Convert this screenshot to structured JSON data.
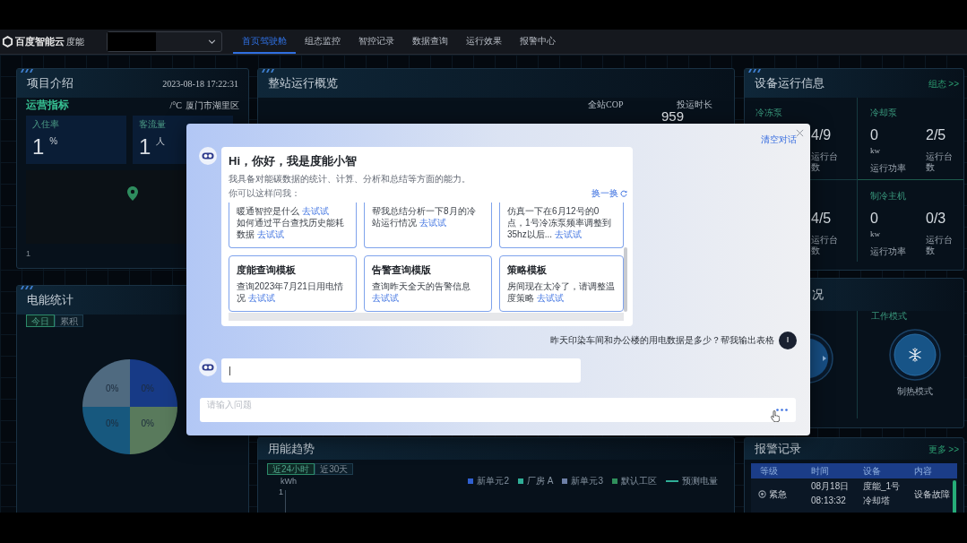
{
  "nav": {
    "logo": "百度智能云",
    "product": "度能",
    "tabs": [
      {
        "label": "首页驾驶舱",
        "selected": true
      },
      {
        "label": "组态监控",
        "selected": false
      },
      {
        "label": "智控记录",
        "selected": false
      },
      {
        "label": "数据查询",
        "selected": false
      },
      {
        "label": "运行效果",
        "selected": false
      },
      {
        "label": "报警中心",
        "selected": false
      }
    ]
  },
  "project_panel": {
    "title": "项目介绍",
    "datetime": "2023-08-18 17:22:31",
    "section": "运营指标",
    "weather": "/°C",
    "location": "厦门市湖里区",
    "stats": [
      {
        "label": "入住率",
        "value": "1",
        "unit": "%"
      },
      {
        "label": "客流量",
        "value": "1",
        "unit": "人"
      }
    ],
    "footer": "1"
  },
  "energy_panel": {
    "title": "电能统计",
    "tabs": [
      {
        "label": "今日",
        "selected": true
      },
      {
        "label": "累积",
        "selected": false
      }
    ],
    "slices": [
      {
        "label": "0%",
        "color": "#4f6a80"
      },
      {
        "label": "0%",
        "color": "#173a86"
      },
      {
        "label": "0%",
        "color": "#17587e"
      },
      {
        "label": "0%",
        "color": "#597a5c"
      }
    ]
  },
  "overview_panel": {
    "title": "整站运行概览",
    "metrics": [
      {
        "label": "全站COP"
      },
      {
        "label": "投运时长",
        "value": "959"
      }
    ]
  },
  "device_panel": {
    "title": "设备运行信息",
    "link": "组态 >>",
    "rows": [
      {
        "groups": [
          {
            "title": "冷冻泵",
            "metrics": [
              {
                "kind": "count",
                "value": "4/9",
                "label": "运行台数"
              }
            ]
          },
          {
            "title": "冷却泵",
            "metrics": [
              {
                "kind": "power",
                "value": "0",
                "unit": "kw",
                "label": "运行功率"
              },
              {
                "kind": "count",
                "value": "2/5",
                "label": "运行台数"
              }
            ]
          }
        ]
      },
      {
        "groups": [
          {
            "metrics": [
              {
                "kind": "count",
                "value": "4/5",
                "label": "运行台数"
              }
            ]
          },
          {
            "title": "制冷主机",
            "metrics": [
              {
                "kind": "power",
                "value": "0",
                "unit": "kw",
                "label": "运行功率"
              },
              {
                "kind": "count",
                "value": "0/3",
                "label": "运行台数"
              }
            ]
          }
        ]
      }
    ]
  },
  "mode_panel": {
    "title": "况",
    "mode": {
      "label": "工作模式",
      "value": "制热模式"
    }
  },
  "trend_panel": {
    "title": "用能趋势",
    "tabs": [
      {
        "label": "近24小时",
        "selected": true
      },
      {
        "label": "近30天",
        "selected": false
      }
    ],
    "unit": "kWh",
    "y_tick": "1",
    "legend": [
      {
        "kind": "square",
        "label": "新单元2",
        "color": "#2f5fd0"
      },
      {
        "kind": "square",
        "label": "厂房 A",
        "color": "#2fae97"
      },
      {
        "kind": "square",
        "label": "新单元3",
        "color": "#6d7fa6"
      },
      {
        "kind": "square",
        "label": "默认工区",
        "color": "#2f8f5b"
      },
      {
        "kind": "line",
        "label": "预测电量",
        "color": "#2fae97"
      }
    ]
  },
  "alarm_panel": {
    "title": "报警记录",
    "link": "更多 >>",
    "columns": [
      "等级",
      "时间",
      "设备",
      "内容"
    ],
    "rows": [
      {
        "level": "紧急",
        "time": [
          "08月18日",
          "08:13:32"
        ],
        "device": [
          "度能_1号",
          "冷却塔"
        ],
        "content": "设备故障"
      }
    ]
  },
  "assistant": {
    "clear_label": "清空对话",
    "welcome": {
      "title": "Hi，你好，我是度能小智",
      "intro": "我具备对能碳数据的统计、计算、分析和总结等方面的能力。",
      "prompt": "你可以这样问我：",
      "refresh": "换一换",
      "suggestions": [
        {
          "items": [
            {
              "text": "暖通智控是什么",
              "link": "去试试"
            },
            {
              "text": "如何通过平台查找历史能耗数据",
              "link": "去试试"
            }
          ]
        },
        {
          "items": [
            {
              "text": "帮我总结分析一下8月的冷站运行情况",
              "link": "去试试"
            }
          ]
        },
        {
          "items": [
            {
              "text": "仿真一下在6月12号的0点，1号冷冻泵频率调整到35hz以后...",
              "link": "去试试"
            }
          ]
        },
        {
          "title": "度能查询模板",
          "items": [
            {
              "text": "查询2023年7月21日用电情况",
              "link": "去试试"
            }
          ]
        },
        {
          "title": "告警查询模版",
          "items": [
            {
              "text": "查询昨天全天的告警信息",
              "link": "去试试"
            }
          ]
        },
        {
          "title": "策略模板",
          "items": [
            {
              "text": "房间现在太冷了，请调整温度策略",
              "link": "去试试"
            }
          ]
        }
      ]
    },
    "messages": [
      {
        "kind": "user",
        "text": "昨天印染车间和办公楼的用电数据是多少？帮我输出表格",
        "avatar": "I"
      },
      {
        "kind": "bot",
        "text": "|"
      }
    ],
    "input": {
      "placeholder": "请输入问题"
    }
  }
}
